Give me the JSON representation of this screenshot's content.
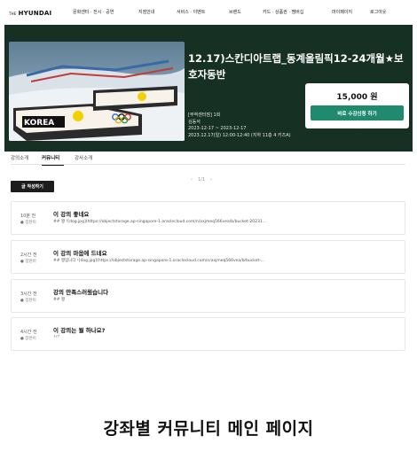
{
  "nav": {
    "logo_prefix": "THE",
    "logo": "HYUNDAI",
    "links": [
      "문화센터 · 전시 · 공연",
      "지점안내",
      "서비스 · 이벤트",
      "브랜드",
      "카드 · 상품권 · 멤버십",
      "마이페이지",
      "로그아웃"
    ]
  },
  "course": {
    "title": "12.17)스칸디아트랩_동계올림픽12-24개월★보호자동반",
    "branch": "[무역센터점] 1회",
    "teacher": "김동석",
    "period": "2023-12-17 ~ 2023-12-17",
    "schedule": "2023.12.17(일) 12:00-12:40 (지하 11층 4 키즈A)",
    "price": "15,000 원",
    "apply_label": "바로 수강신청 하기",
    "image_text": "KOREA"
  },
  "tabs": [
    "강의소개",
    "커뮤니티",
    "강사소개"
  ],
  "toolbar": {
    "write_label": "글 작성하기",
    "pager_prev": "‹",
    "pager_text": "1/1",
    "pager_next": "›"
  },
  "posts": [
    {
      "time": "10분 전",
      "author": "장현이",
      "title": "이 강의 좋네요",
      "body": "## 짱 ![dog.jpg](https://objectstorage.ap-singapore-1.oraclecloud.com/n/axjmeq566vea/b/bucket-20231..."
    },
    {
      "time": "2시간 전",
      "author": "장현이",
      "title": "이 강의 마음에 드네요",
      "body": "## 짱입니다 ![dog.jpg](https://objectstorage.ap-singapore-1.oraclecloud.com/n/axjmeq566vea/b/bucket-..."
    },
    {
      "time": "3시간 전",
      "author": "장현이",
      "title": "강의 만족스러웠습니다",
      "body": "## 짱"
    },
    {
      "time": "4시간 전",
      "author": "장현이",
      "title": "이 강의는 뭘 하나요?",
      "body": "???"
    }
  ],
  "caption": "강좌별 커뮤니티 메인 페이지",
  "colors": {
    "hero_bg": "#173024",
    "accent": "#1f8a6e",
    "button_dark": "#1c1c1c"
  }
}
